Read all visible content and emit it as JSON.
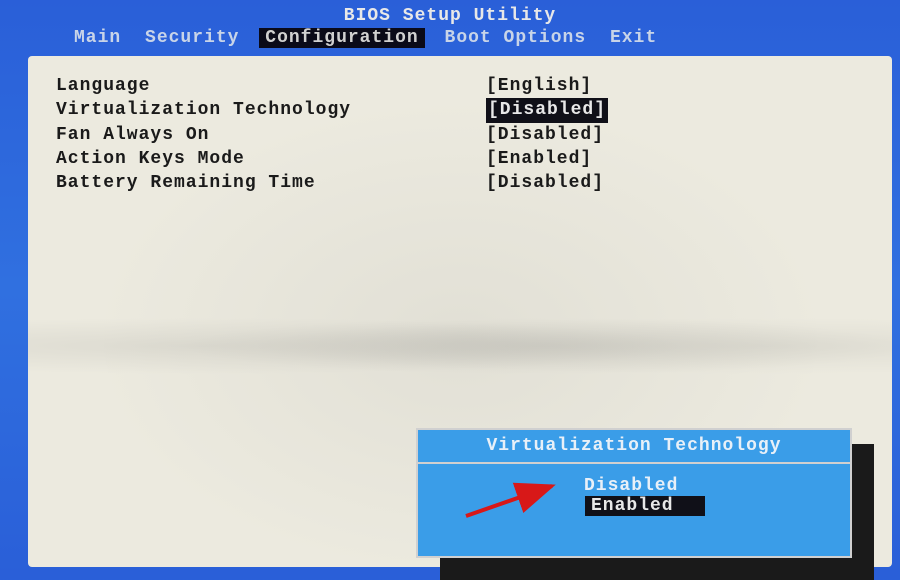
{
  "header": {
    "title": "BIOS Setup Utility"
  },
  "menu": {
    "items": [
      {
        "label": "Main",
        "active": false
      },
      {
        "label": "Security",
        "active": false
      },
      {
        "label": "Configuration",
        "active": true
      },
      {
        "label": "Boot Options",
        "active": false
      },
      {
        "label": "Exit",
        "active": false
      }
    ]
  },
  "settings": [
    {
      "label": "Language",
      "value": "[English]",
      "highlighted": false
    },
    {
      "label": "Virtualization Technology",
      "value": "[Disabled]",
      "highlighted": true
    },
    {
      "label": "Fan Always On",
      "value": "[Disabled]",
      "highlighted": false
    },
    {
      "label": "Action Keys Mode",
      "value": "[Enabled]",
      "highlighted": false
    },
    {
      "label": "Battery Remaining Time",
      "value": "[Disabled]",
      "highlighted": false
    }
  ],
  "popup": {
    "title": "Virtualization Technology",
    "options": [
      {
        "label": "Disabled",
        "selected": false
      },
      {
        "label": "Enabled",
        "selected": true
      }
    ]
  },
  "annotation": {
    "arrow_color": "#d81818"
  }
}
